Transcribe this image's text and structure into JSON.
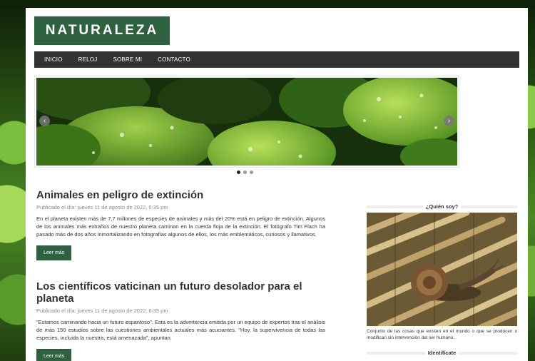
{
  "header": {
    "logo": "NATURALEZA"
  },
  "nav": {
    "items": [
      {
        "label": "INICIO"
      },
      {
        "label": "RELOJ"
      },
      {
        "label": "SOBRE MI"
      },
      {
        "label": "CONTACTO"
      }
    ]
  },
  "slider": {
    "prev_icon": "chevron-left-icon",
    "next_icon": "chevron-right-icon",
    "dots": 3,
    "active": 0
  },
  "posts": [
    {
      "title": "Animales en peligro de extinción",
      "meta": "Publicado el día: jueves 11 de agosto de 2022, 6:35 pm",
      "body": "En el planeta existen más de 7,7 millones de especies de animales y más del 20% está en peligro de extinción. Algunos de los animales más extraños de nuestro planeta caminan en la cuerda floja de la extinción. El fotógrafo Tim Flach ha pasado más de dos años inmortalizando en fotografías algunos de ellos, los más emblemáticos, curiosos y llamativos.",
      "button": "Leer más"
    },
    {
      "title": "Los científicos vaticinan un futuro desolador para el planeta",
      "meta": "Publicado el día: jueves 11 de agosto de 2022, 6:35 pm",
      "body": "\"Estamos caminando hacia un futuro espantoso\". Esta es la advertencia emitida por un equipo de expertos tras el análisis de más 150 estudios sobre las cuestiones ambientales actuales más acuciantes. \"Hoy, la supervivencia de todas las especies, incluida la nuestra, está amenazada\", apuntan.",
      "button": "Leer más"
    }
  ],
  "sidebar": {
    "title": "¿Quién soy?",
    "caption": "Conjunto de las cosas que existen en el mundo o que se producen o modifican sin intervención del ser humano.",
    "next_title": "Identifícate"
  }
}
